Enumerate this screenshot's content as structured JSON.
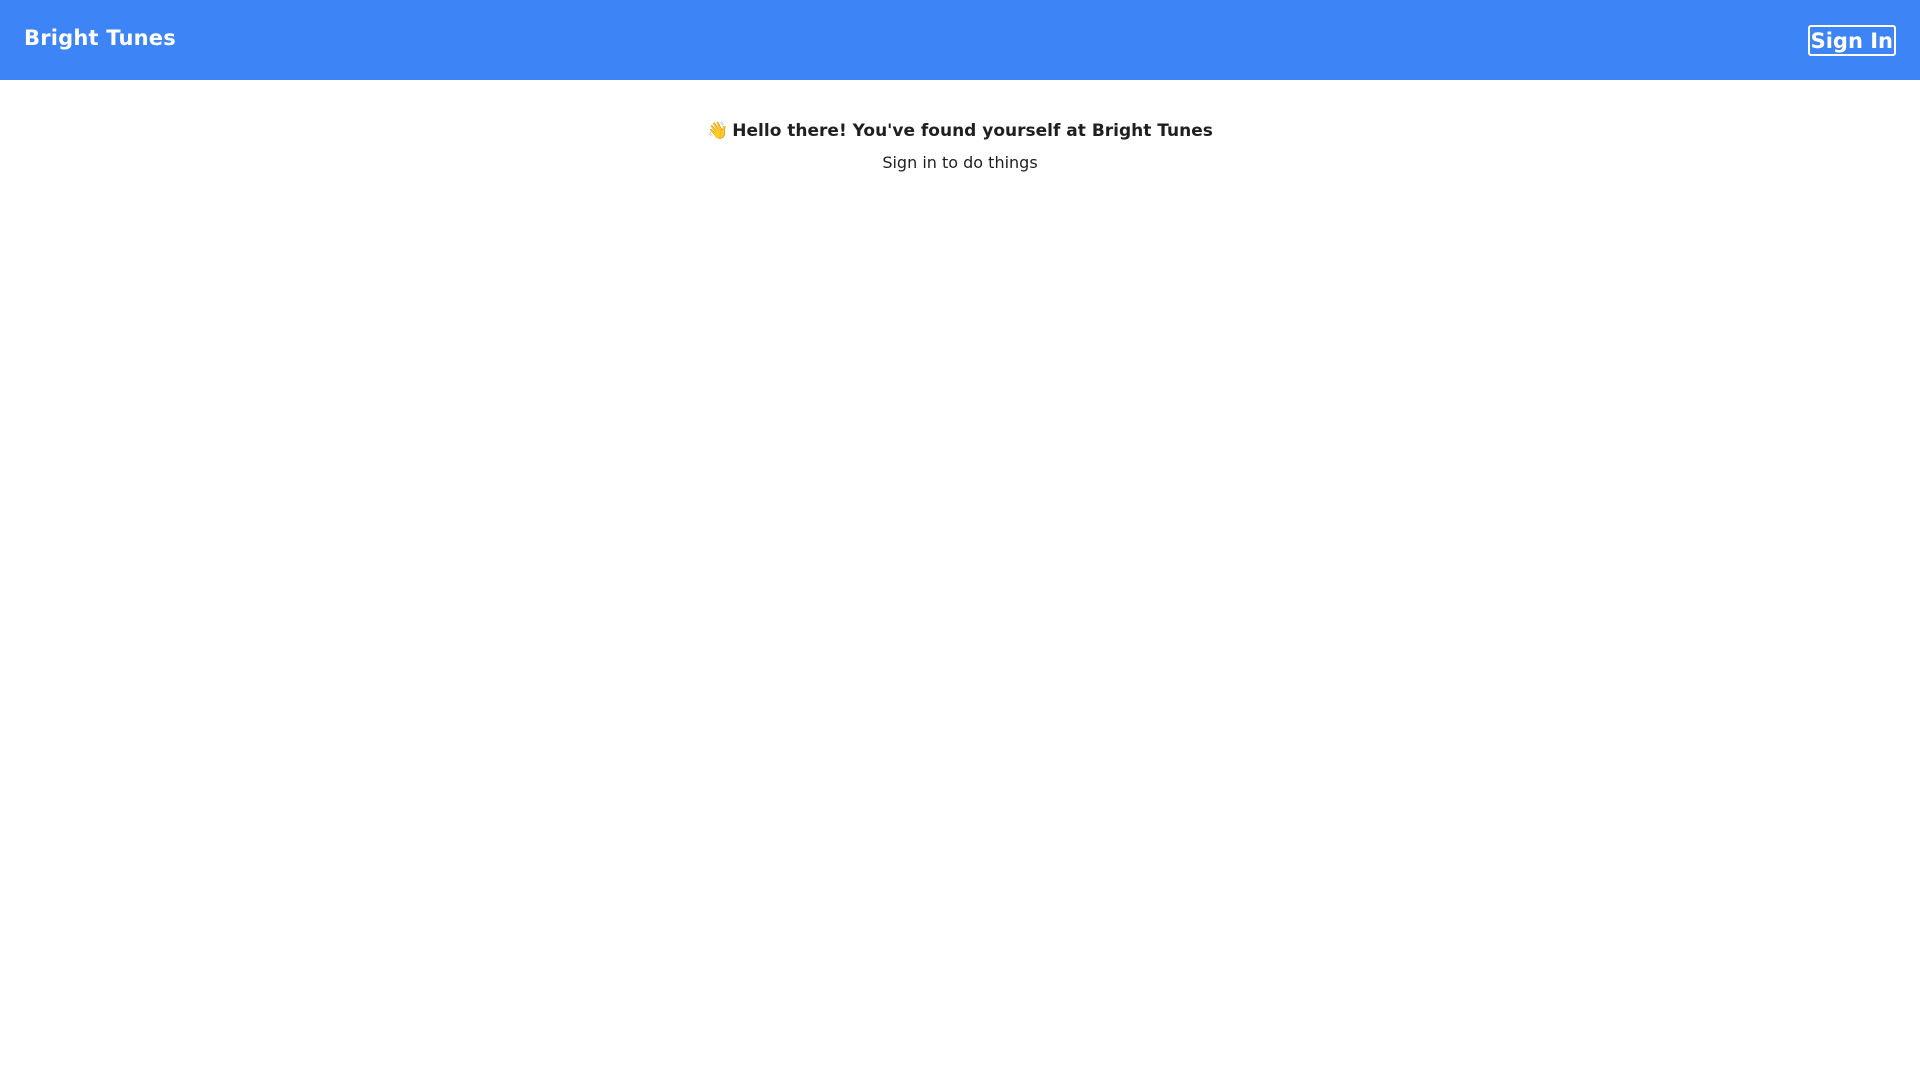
{
  "header": {
    "brand": "Bright Tunes",
    "sign_in_label": "Sign In"
  },
  "main": {
    "wave_icon": "👋",
    "welcome_text": "Hello there! You've found yourself at Bright Tunes",
    "subtitle": "Sign in to do things"
  },
  "colors": {
    "header_bg": "#3d84f7",
    "header_text": "#ffffff",
    "body_text": "#1f1f1f"
  }
}
